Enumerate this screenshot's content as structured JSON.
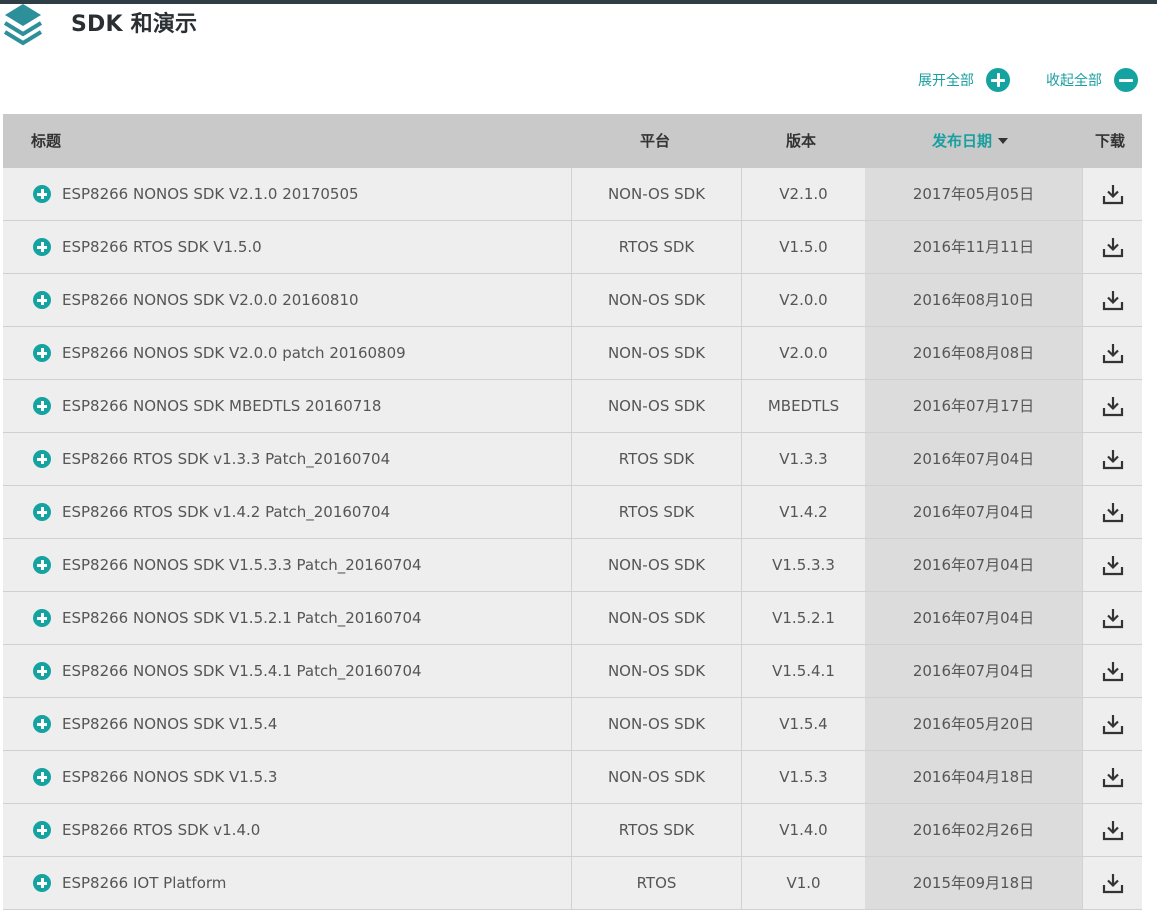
{
  "page": {
    "title": "SDK 和演示",
    "expand_all": "展开全部",
    "collapse_all": "收起全部"
  },
  "colors": {
    "accent": "#14a3a0",
    "header_bg": "#c9c9c9",
    "row_bg": "#eeeeee",
    "date_col_bg": "#dcdcdc"
  },
  "table": {
    "headers": {
      "title": "标题",
      "platform": "平台",
      "version": "版本",
      "date": "发布日期",
      "download": "下载"
    },
    "sort": {
      "column": "date",
      "direction": "descending"
    },
    "rows": [
      {
        "title": "ESP8266 NONOS SDK V2.1.0 20170505",
        "platform": "NON-OS SDK",
        "version": "V2.1.0",
        "date": "2017年05月05日"
      },
      {
        "title": "ESP8266 RTOS SDK V1.5.0",
        "platform": "RTOS SDK",
        "version": "V1.5.0",
        "date": "2016年11月11日"
      },
      {
        "title": "ESP8266 NONOS SDK V2.0.0 20160810",
        "platform": "NON-OS SDK",
        "version": "V2.0.0",
        "date": "2016年08月10日"
      },
      {
        "title": "ESP8266 NONOS SDK V2.0.0 patch 20160809",
        "platform": "NON-OS SDK",
        "version": "V2.0.0",
        "date": "2016年08月08日"
      },
      {
        "title": "ESP8266 NONOS SDK MBEDTLS 20160718",
        "platform": "NON-OS SDK",
        "version": "MBEDTLS",
        "date": "2016年07月17日"
      },
      {
        "title": "ESP8266 RTOS SDK v1.3.3 Patch_20160704",
        "platform": "RTOS SDK",
        "version": "V1.3.3",
        "date": "2016年07月04日"
      },
      {
        "title": "ESP8266 RTOS SDK v1.4.2 Patch_20160704",
        "platform": "RTOS SDK",
        "version": "V1.4.2",
        "date": "2016年07月04日"
      },
      {
        "title": "ESP8266 NONOS SDK V1.5.3.3 Patch_20160704",
        "platform": "NON-OS SDK",
        "version": "V1.5.3.3",
        "date": "2016年07月04日"
      },
      {
        "title": "ESP8266 NONOS SDK V1.5.2.1 Patch_20160704",
        "platform": "NON-OS SDK",
        "version": "V1.5.2.1",
        "date": "2016年07月04日"
      },
      {
        "title": "ESP8266 NONOS SDK V1.5.4.1 Patch_20160704",
        "platform": "NON-OS SDK",
        "version": "V1.5.4.1",
        "date": "2016年07月04日"
      },
      {
        "title": "ESP8266 NONOS SDK V1.5.4",
        "platform": "NON-OS SDK",
        "version": "V1.5.4",
        "date": "2016年05月20日"
      },
      {
        "title": "ESP8266 NONOS SDK V1.5.3",
        "platform": "NON-OS SDK",
        "version": "V1.5.3",
        "date": "2016年04月18日"
      },
      {
        "title": "ESP8266 RTOS SDK v1.4.0",
        "platform": "RTOS SDK",
        "version": "V1.4.0",
        "date": "2016年02月26日"
      },
      {
        "title": "ESP8266 IOT Platform",
        "platform": "RTOS",
        "version": "V1.0",
        "date": "2015年09月18日"
      }
    ]
  },
  "icons": {
    "logo": "layers-stack-icon",
    "expand": "plus-circle-icon",
    "collapse": "minus-circle-icon",
    "row_expand": "plus-circle-icon",
    "download": "download-tray-icon",
    "sort": "caret-down-icon"
  }
}
